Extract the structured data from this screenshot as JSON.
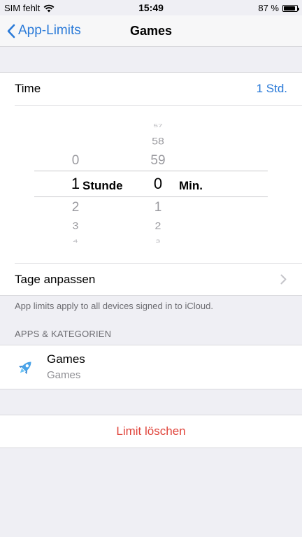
{
  "status_bar": {
    "carrier": "SIM fehlt",
    "time": "15:49",
    "battery_text": "87 %",
    "battery_level": 0.87
  },
  "nav": {
    "back_label": "App-Limits",
    "title": "Games"
  },
  "time_row": {
    "label": "Time",
    "value": "1 Std."
  },
  "picker": {
    "hours": {
      "above": [
        "0"
      ],
      "selected": "1",
      "below": [
        "2",
        "3",
        "4"
      ],
      "unit": "Stunde"
    },
    "minutes": {
      "above": [
        "57",
        "58",
        "59"
      ],
      "selected": "0",
      "below": [
        "1",
        "2",
        "3"
      ],
      "unit": "Min."
    }
  },
  "days_row": {
    "label": "Tage anpassen"
  },
  "footnote": "App limits apply to all devices signed in to iCloud.",
  "section_header": "APPS & KATEGORIEN",
  "app_item": {
    "title": "Games",
    "subtitle": "Games",
    "icon": "rocket-icon"
  },
  "delete_button": "Limit löschen",
  "colors": {
    "accent": "#2a7ad8",
    "destructive": "#e0443b",
    "background": "#efeff4"
  }
}
